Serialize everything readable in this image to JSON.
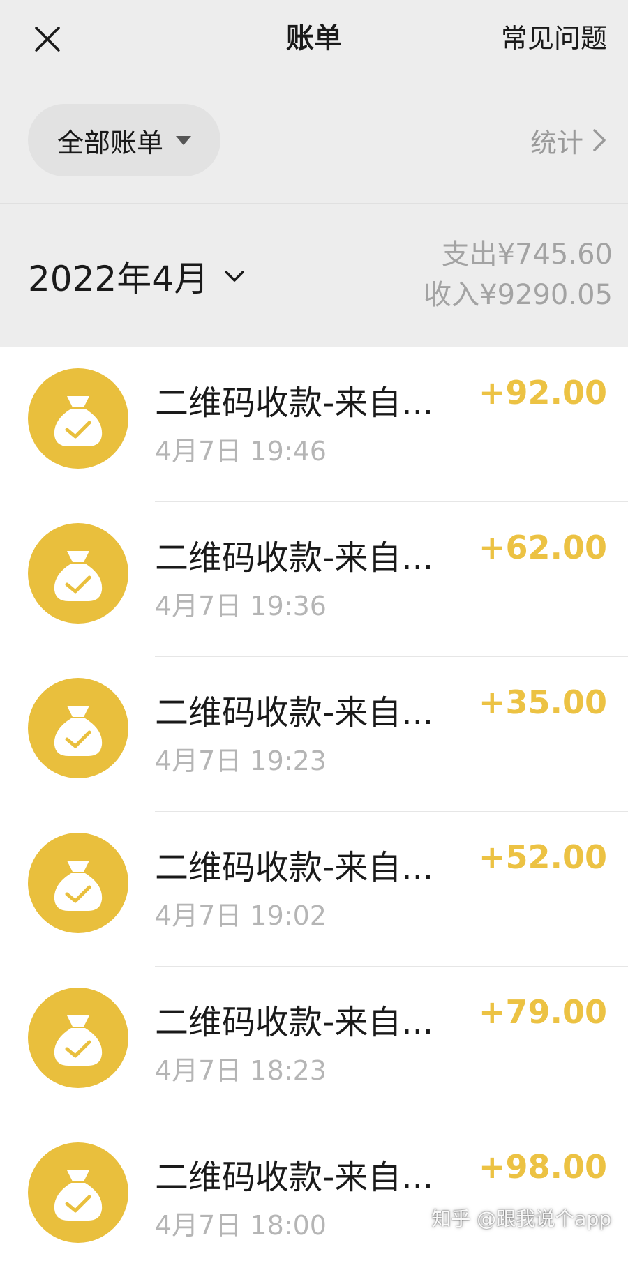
{
  "header": {
    "title": "账单",
    "faq_label": "常见问题",
    "close_icon": "close-icon"
  },
  "filter": {
    "selected": "全部账单",
    "stats_label": "统计"
  },
  "summary": {
    "month": "2022年4月",
    "expense": "支出¥745.60",
    "income": "收入¥9290.05"
  },
  "colors": {
    "accent": "#ecc243",
    "icon_bg": "#e9bf3d",
    "bar_bg": "#ededed"
  },
  "transactions": [
    {
      "title": "二维码收款-来自...",
      "time": "4月7日 19:46",
      "amount": "+92.00"
    },
    {
      "title": "二维码收款-来自...",
      "time": "4月7日 19:36",
      "amount": "+62.00"
    },
    {
      "title": "二维码收款-来自...",
      "time": "4月7日 19:23",
      "amount": "+35.00"
    },
    {
      "title": "二维码收款-来自...",
      "time": "4月7日 19:02",
      "amount": "+52.00"
    },
    {
      "title": "二维码收款-来自...",
      "time": "4月7日 18:23",
      "amount": "+79.00"
    },
    {
      "title": "二维码收款-来自...",
      "time": "4月7日 18:00",
      "amount": "+98.00"
    }
  ],
  "watermark": "知乎 @跟我说个app"
}
